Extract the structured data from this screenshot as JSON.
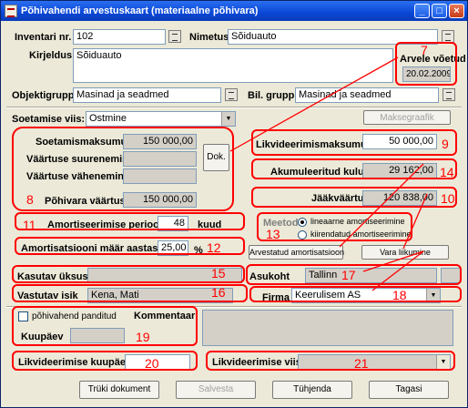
{
  "window": {
    "title": "Põhivahendi arvestuskaart (materiaalne põhivara)"
  },
  "top": {
    "inventari_label": "Inventari nr.",
    "inventari_value": "102",
    "nimetus_label": "Nimetus",
    "nimetus_value": "Sõiduauto",
    "kirjeldus_label": "Kirjeldus",
    "kirjeldus_value": "Sõiduauto",
    "arvele_label": "Arvele võetud",
    "arvele_value": "20.02.2009",
    "objektigrupp_label": "Objektigrupp",
    "objektigrupp_value": "Masinad ja seadmed",
    "bilgrupp_label": "Bil. grupp",
    "bilgrupp_value": "Masinad ja seadmed"
  },
  "soetamine": {
    "viis_label": "Soetamise viis:",
    "viis_value": "Ostmine",
    "maksegraafik": "Maksegraafik",
    "maksumus_label": "Soetamismaksumus",
    "maksumus_value": "150 000,00",
    "suurenemine_label": "Väärtuse suurenemine",
    "vahenemine_label": "Väärtuse vähenemine",
    "dok": "Dok.",
    "pohivara_label": "Põhivara väärtus",
    "pohivara_value": "150 000,00"
  },
  "likvideerimine": {
    "maksumus_label": "Likvideerimismaksumus",
    "maksumus_value": "50 000,00",
    "kulum_label": "Akumuleeritud kulum",
    "kulum_value": "29 162,00",
    "jaak_label": "Jääkväärtus",
    "jaak_value": "120 838,00"
  },
  "amortisatsioon": {
    "periood_label": "Amortiseerimise periood",
    "periood_value": "48",
    "periood_unit": "kuud",
    "maar_label": "Amortisatsiooni määr aastas",
    "maar_value": "25,00",
    "maar_unit": "%",
    "meetod_label": "Meetod:",
    "meetod_options": [
      "lineaarne amortiseerimine",
      "kiirendatud amortiseerimine"
    ],
    "arvestatud_btn": "Arvestatud amortisatsioon",
    "vara_btn": "Vara liikumine"
  },
  "kasutus": {
    "uksus_label": "Kasutav üksus",
    "uksus_value": "",
    "asukoht_label": "Asukoht",
    "asukoht_value": "Tallinn",
    "isik_label": "Vastutav isik",
    "isik_value": "Kena, Mati",
    "firma_label": "Firma",
    "firma_value": "Keerulisem AS"
  },
  "pant": {
    "checkbox_label": "põhivahend panditud",
    "kommentaar_label": "Kommentaar",
    "kuupaev_label": "Kuupäev"
  },
  "likv2": {
    "kuupaev_label": "Likvideerimise kuupäev",
    "kuupaev_value": "",
    "viis_label": "Likvideerimise viis:"
  },
  "buttons": {
    "print": "Trüki dokument",
    "save": "Salvesta",
    "clear": "Tühjenda",
    "back": "Tagasi"
  },
  "annotations": [
    "7",
    "8",
    "9",
    "10",
    "11",
    "12",
    "13",
    "14",
    "15",
    "16",
    "17",
    "18",
    "19",
    "20",
    "21"
  ],
  "colors": {
    "annotation_red": "#ff0000",
    "title_blue": "#0a47d6",
    "face": "#ece9d8"
  }
}
